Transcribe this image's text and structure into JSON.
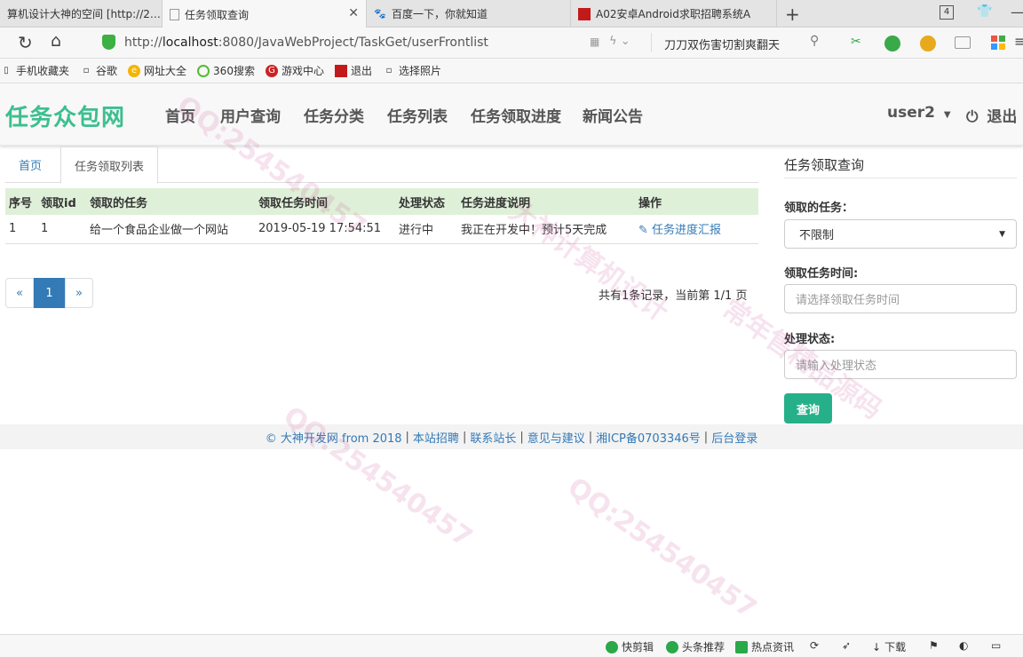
{
  "browser": {
    "tabs": [
      {
        "title": "算机设计大神的空间 [http://2…",
        "active": false
      },
      {
        "title": "任务领取查询",
        "active": true
      },
      {
        "title": "百度一下，你就知道",
        "active": false
      },
      {
        "title": "A02安卓Android求职招聘系统A",
        "active": false
      }
    ],
    "tab_count": "4",
    "url_prefix": "http://",
    "url_host": "localhost",
    "url_rest": ":8080/JavaWebProject/TaskGet/userFrontlist",
    "search_text": "刀刀双伤害切割爽翻天",
    "bookmarks": [
      "手机收藏夹",
      "谷歌",
      "网址大全",
      "360搜索",
      "游戏中心",
      "退出",
      "选择照片"
    ]
  },
  "site": {
    "brand": "任务众包网",
    "nav": [
      "首页",
      "用户查询",
      "任务分类",
      "任务列表",
      "任务领取进度",
      "新闻公告"
    ],
    "user": "user2",
    "logout": "退出"
  },
  "content": {
    "tabs": [
      "首页",
      "任务领取列表"
    ],
    "table": {
      "headers": [
        "序号",
        "领取id",
        "领取的任务",
        "领取任务时间",
        "处理状态",
        "任务进度说明",
        "操作"
      ],
      "rows": [
        [
          "1",
          "1",
          "给一个食品企业做一个网站",
          "2019-05-19 17:54:51",
          "进行中",
          "我正在开发中！预计5天完成",
          "任务进度汇报"
        ]
      ]
    },
    "pagination": {
      "prev": "«",
      "current": "1",
      "next": "»"
    },
    "record_info": "共有1条记录，当前第 1/1 页"
  },
  "side": {
    "title": "任务领取查询",
    "task_label": "领取的任务：",
    "task_value": "不限制",
    "time_label": "领取任务时间:",
    "time_placeholder": "请选择领取任务时间",
    "state_label": "处理状态:",
    "state_placeholder": "请输入处理状态",
    "query_button": "查询"
  },
  "footer": {
    "copyright": "© 大神开发网 from 2018",
    "links": [
      "本站招聘",
      "联系站长",
      "意见与建议",
      "湘ICP备0703346号",
      "后台登录"
    ]
  },
  "statusbar": [
    "快剪辑",
    "头条推荐",
    "热点资讯",
    "下载"
  ],
  "watermarks": [
    "QQ:254540457",
    "大神计算机设计",
    "常年售精品源码"
  ],
  "colors": {
    "brand": "#3cbf8f",
    "link": "#337ab7",
    "button": "#26b08a",
    "table_header": "#dff0d8"
  }
}
